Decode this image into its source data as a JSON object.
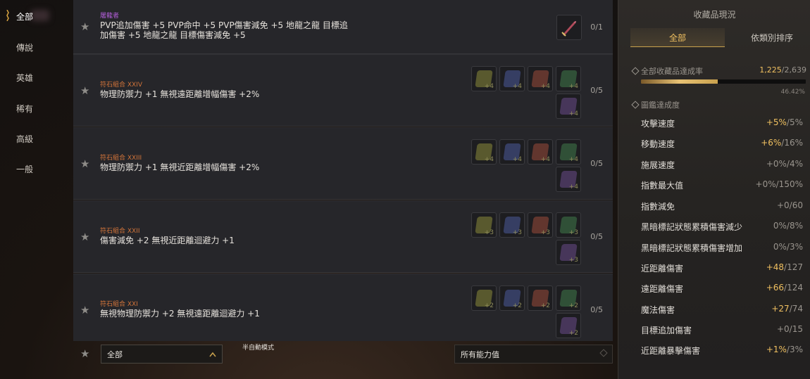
{
  "nav": {
    "items": [
      {
        "label": "全部",
        "active": true
      },
      {
        "label": "傳說",
        "active": false
      },
      {
        "label": "英雄",
        "active": false
      },
      {
        "label": "稀有",
        "active": false
      },
      {
        "label": "高級",
        "active": false
      },
      {
        "label": "一般",
        "active": false
      }
    ]
  },
  "entries": [
    {
      "category": "屠龍者",
      "category_color": "#b25ed8",
      "description": "PVP追加傷害 +5 PVP命中 +5 PVP傷害減免 +5 地龍之龍 目標追加傷害 +5 地龍之龍 目標傷害減免 +5",
      "count": "0/1"
    },
    {
      "category": "符石組合 XXIV",
      "category_color": "#d2743a",
      "description": "物理防禦力 +1 無視遠距離增幅傷害 +2%",
      "count": "0/5",
      "slot_level": "+4"
    },
    {
      "category": "符石組合 XXIII",
      "category_color": "#d2743a",
      "description": "物理防禦力 +1 無視近距離增幅傷害 +2%",
      "count": "0/5",
      "slot_level": "+4"
    },
    {
      "category": "符石組合 XXII",
      "category_color": "#d2743a",
      "description": "傷害減免 +2 無視近距離迴避力 +1",
      "count": "0/5",
      "slot_level": "+3"
    },
    {
      "category": "符石組合 XXI",
      "category_color": "#d2743a",
      "description": "無視物理防禦力 +2 無視遠距離迴避力 +1",
      "count": "0/5",
      "slot_level": "+2"
    }
  ],
  "gem_colors": [
    "#8a8a3a",
    "#4a5a9a",
    "#9a4a3a",
    "#3f7a4a",
    "#6a4a8a"
  ],
  "bottom": {
    "filter_label": "全部",
    "semi_auto": "半自動模式",
    "ability_filter": "所有能力值"
  },
  "panel": {
    "title": "收藏品現況",
    "tabs": [
      {
        "label": "全部",
        "active": true
      },
      {
        "label": "依類別排序",
        "active": false
      }
    ],
    "overall_label": "全部收藏品達成率",
    "overall_done": "1,225",
    "overall_total": "/2,639",
    "overall_percent": "46.42%",
    "overall_fraction": 0.4642,
    "codex_label": "圖鑑達成度",
    "stats": [
      {
        "label": "攻擊速度",
        "bonus": "+5%",
        "rest": "/5%"
      },
      {
        "label": "移動速度",
        "bonus": "+6%",
        "rest": "/16%"
      },
      {
        "label": "施展速度",
        "bonus": "",
        "rest": "+0%/4%"
      },
      {
        "label": "指數最大值",
        "bonus": "",
        "rest": "+0%/150%"
      },
      {
        "label": "指數減免",
        "bonus": "",
        "rest": "+0/60"
      },
      {
        "label": "黑暗標記狀態累積傷害減少",
        "bonus": "",
        "rest": "0%/8%"
      },
      {
        "label": "黑暗標記狀態累積傷害增加",
        "bonus": "",
        "rest": "0%/3%"
      },
      {
        "label": "近距離傷害",
        "bonus": "+48",
        "rest": "/127"
      },
      {
        "label": "遠距離傷害",
        "bonus": "+66",
        "rest": "/124"
      },
      {
        "label": "魔法傷害",
        "bonus": "+27",
        "rest": "/74"
      },
      {
        "label": "目標追加傷害",
        "bonus": "",
        "rest": "+0/15"
      },
      {
        "label": "近距離暴擊傷害",
        "bonus": "+1%",
        "rest": "/3%"
      }
    ]
  }
}
